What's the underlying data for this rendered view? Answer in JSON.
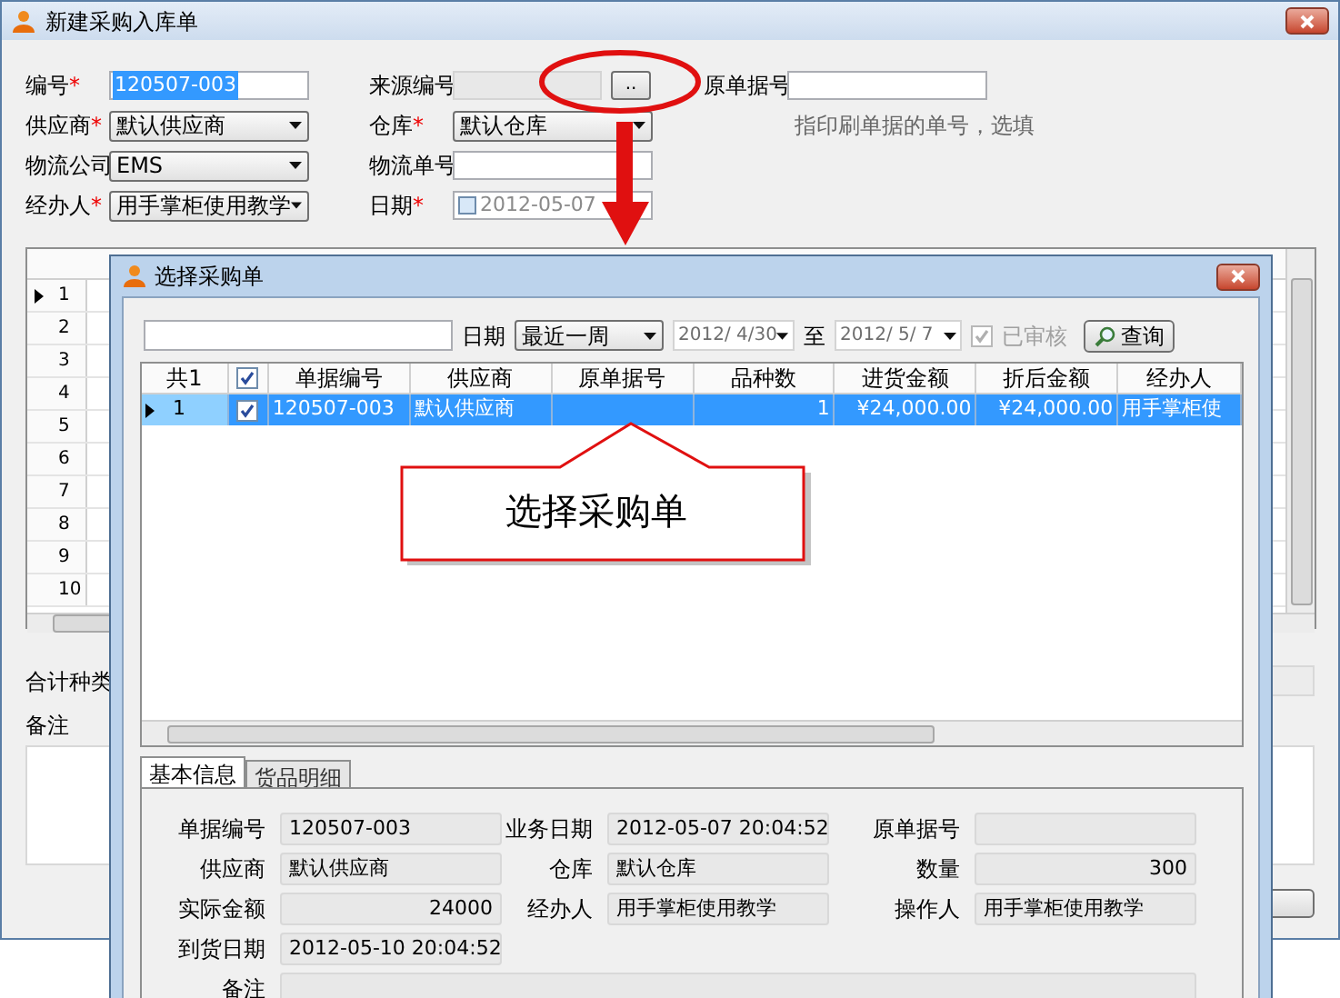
{
  "main_window": {
    "title": "新建采购入库单",
    "form_columns": [
      [
        {
          "kind": "input",
          "label": "编号",
          "required_mark": "*",
          "value": "120507-003",
          "highlighted": true
        },
        {
          "kind": "select",
          "label": "供应商",
          "required_mark": "*",
          "value": "默认供应商"
        },
        {
          "kind": "select",
          "label": "物流公司",
          "value": "EMS"
        },
        {
          "kind": "select",
          "label": "经办人",
          "required_mark": "*",
          "value": "用手掌柜使用教学"
        }
      ],
      [
        {
          "kind": "lookup",
          "label": "来源编号",
          "disabled": true,
          "button": ".."
        },
        {
          "kind": "select",
          "label": "仓库",
          "required_mark": "*",
          "value": "默认仓库"
        },
        {
          "kind": "input",
          "label": "物流单号"
        },
        {
          "kind": "date",
          "label": "日期",
          "required_mark": "*",
          "checked": false,
          "value": "2012-05-07"
        }
      ],
      [
        {
          "kind": "input",
          "label": "原单据号"
        },
        {
          "kind": "hint",
          "text": "指印刷单据的单号，选填"
        }
      ]
    ],
    "grid": {
      "rows": [
        {
          "number": "1",
          "current": true
        },
        {
          "number": "2",
          "current": false
        },
        {
          "number": "3",
          "current": false
        },
        {
          "number": "4",
          "current": false
        },
        {
          "number": "5",
          "current": false
        },
        {
          "number": "6",
          "current": false
        },
        {
          "number": "7",
          "current": false
        },
        {
          "number": "8",
          "current": false
        },
        {
          "number": "9",
          "current": false
        },
        {
          "number": "10",
          "current": false
        }
      ]
    },
    "total_label": "合计种类",
    "notes_label": "备注"
  },
  "dialog": {
    "title": "选择采购单",
    "toolbar": {
      "date_label": "日期",
      "period": "最近一周",
      "from": "2012/ 4/30",
      "to_label": "至",
      "to": "2012/ 5/ 7",
      "audited": {
        "label": "已审核",
        "checked": true,
        "disabled": true
      },
      "query_button": "查询"
    },
    "table": {
      "columns": [
        {
          "kind": "text",
          "label": "共1"
        },
        {
          "kind": "checkbox",
          "checked": true
        },
        {
          "kind": "text",
          "label": "单据编号"
        },
        {
          "kind": "text",
          "label": "供应商"
        },
        {
          "kind": "text",
          "label": "原单据号"
        },
        {
          "kind": "text",
          "label": "品种数"
        },
        {
          "kind": "text",
          "label": "进货金额"
        },
        {
          "kind": "text",
          "label": "折后金额"
        },
        {
          "kind": "text",
          "label": "经办人"
        }
      ],
      "rows": [
        {
          "selected": true,
          "current": true,
          "cells": [
            {
              "kind": "number",
              "text": "1"
            },
            {
              "kind": "checkbox",
              "checked": true
            },
            {
              "kind": "text",
              "text": "120507-003"
            },
            {
              "kind": "text",
              "text": "默认供应商"
            },
            {
              "kind": "blank"
            },
            {
              "kind": "number",
              "text": "1"
            },
            {
              "kind": "number",
              "text": "¥24,000.00"
            },
            {
              "kind": "number",
              "text": "¥24,000.00"
            },
            {
              "kind": "text",
              "text": "用手掌柜使"
            }
          ]
        }
      ]
    },
    "tabs": [
      {
        "label": "基本信息",
        "selected": true
      },
      {
        "label": "货品明细",
        "selected": false
      }
    ],
    "details": [
      [
        {
          "kind": "text",
          "label": "单据编号",
          "value": "120507-003"
        },
        {
          "kind": "text",
          "label": "业务日期",
          "value": "2012-05-07 20:04:52"
        },
        {
          "kind": "text",
          "label": "原单据号"
        }
      ],
      [
        {
          "kind": "text",
          "label": "供应商",
          "value": "默认供应商"
        },
        {
          "kind": "text",
          "label": "仓库",
          "value": "默认仓库"
        },
        {
          "kind": "number",
          "label": "数量",
          "value": "300"
        }
      ],
      [
        {
          "kind": "number",
          "label": "实际金额",
          "value": "24000"
        },
        {
          "kind": "text",
          "label": "经办人",
          "value": "用手掌柜使用教学"
        },
        {
          "kind": "text",
          "label": "操作人",
          "value": "用手掌柜使用教学"
        }
      ],
      [
        {
          "kind": "text",
          "label": "到货日期",
          "value": "2012-05-10 20:04:52"
        }
      ],
      [
        {
          "kind": "wide",
          "label": "备注"
        }
      ]
    ]
  },
  "callout": {
    "text": "选择采购单"
  }
}
